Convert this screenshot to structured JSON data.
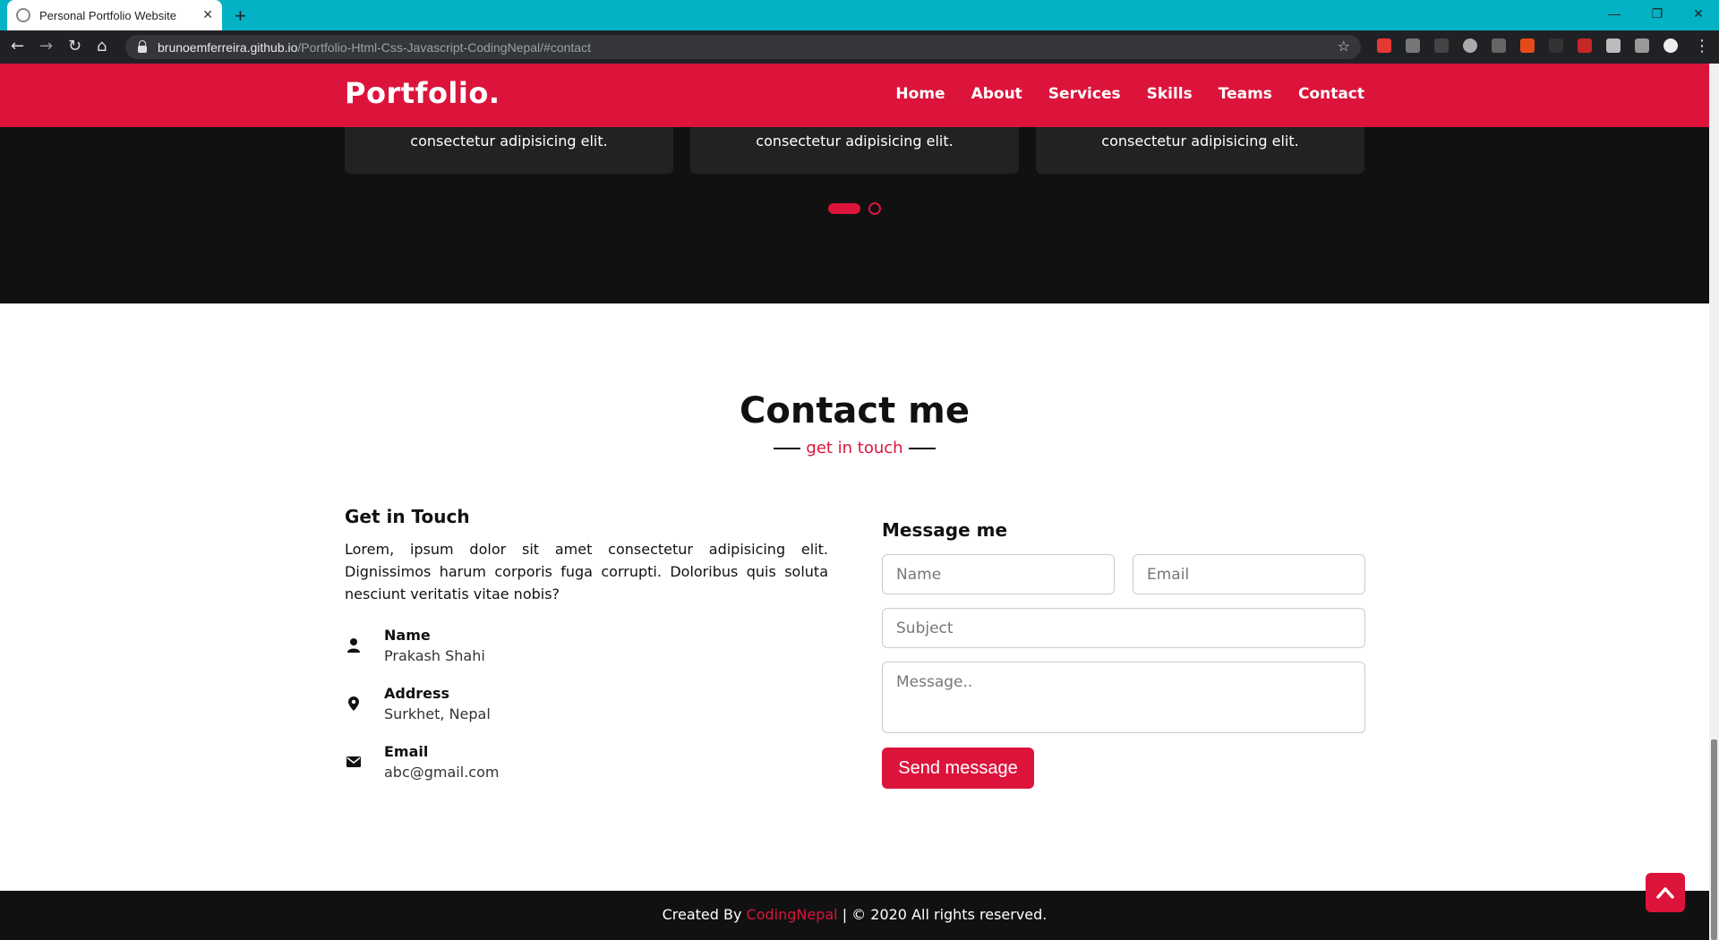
{
  "browser": {
    "tab_title": "Personal Portfolio Website",
    "tab_close": "✕",
    "new_tab": "+",
    "url_host": "brunoemferreira.github.io",
    "url_path": "/Portfolio-Html-Css-Javascript-CodingNepal/#contact",
    "minimize": "—",
    "restore": "❐",
    "close": "✕"
  },
  "site": {
    "logo": "Portfolio.",
    "menu": [
      "Home",
      "About",
      "Services",
      "Skills",
      "Teams",
      "Contact"
    ],
    "accent_color": "#dc143c"
  },
  "teams": {
    "cards": [
      {
        "text": "consectetur adipisicing elit."
      },
      {
        "text": "consectetur adipisicing elit."
      },
      {
        "text": "consectetur adipisicing elit."
      }
    ]
  },
  "contact": {
    "title": "Contact me",
    "subtitle": "get in touch",
    "left": {
      "heading": "Get in Touch",
      "paragraph": "Lorem, ipsum dolor sit amet consectetur adipisicing elit. Dignissimos harum corporis fuga corrupti. Doloribus quis soluta nesciunt veritatis vitae nobis?",
      "items": [
        {
          "head": "Name",
          "sub": "Prakash Shahi",
          "icon": "user-icon"
        },
        {
          "head": "Address",
          "sub": "Surkhet, Nepal",
          "icon": "map-marker-icon"
        },
        {
          "head": "Email",
          "sub": "abc@gmail.com",
          "icon": "envelope-icon"
        }
      ]
    },
    "right": {
      "heading": "Message me",
      "name_placeholder": "Name",
      "email_placeholder": "Email",
      "subject_placeholder": "Subject",
      "message_placeholder": "Message..",
      "send_label": "Send message"
    }
  },
  "footer": {
    "prefix": "Created By ",
    "brand": "CodingNepal",
    "suffix": " | © 2020 All rights reserved."
  }
}
